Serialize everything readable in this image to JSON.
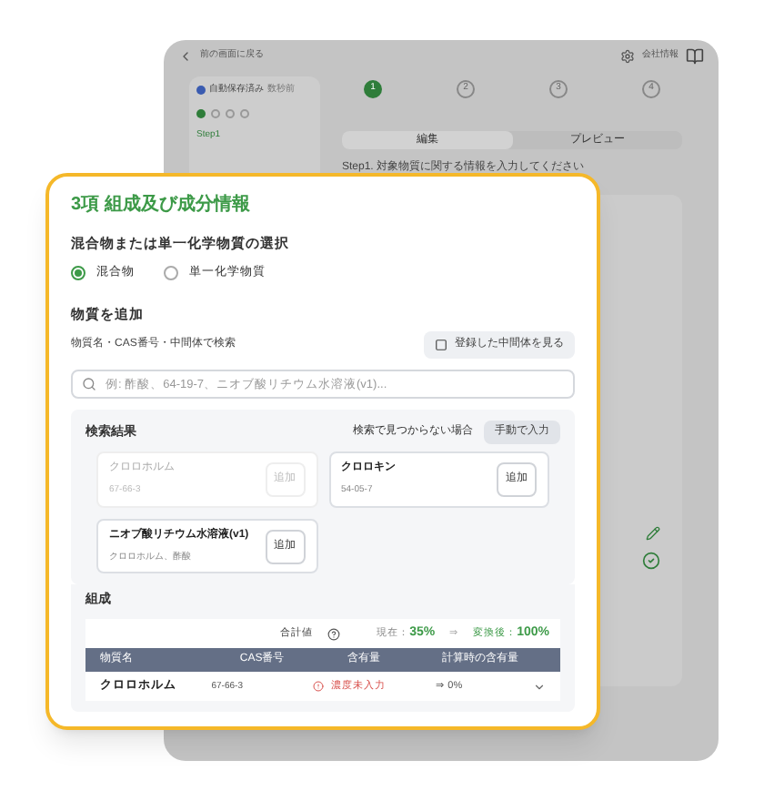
{
  "background_app": {
    "back_link": "前の画面に戻る",
    "company_info": "会社情報",
    "autosave": {
      "status": "自動保存済み",
      "time": "数秒前",
      "saved": true
    },
    "sidebar_step": "Step1",
    "steps": [
      {
        "number": "1",
        "current": true
      },
      {
        "number": "2",
        "current": false
      },
      {
        "number": "3",
        "current": false
      },
      {
        "number": "4",
        "current": false
      }
    ],
    "tabs": [
      {
        "label": "編集",
        "selected": true
      },
      {
        "label": "プレビュー",
        "selected": false
      }
    ],
    "heading": "Step1. 対象物質に関する情報を入力してください"
  },
  "card": {
    "title": "3項 組成及び成分情報",
    "type_section": {
      "heading": "混合物または単一化学物質の選択",
      "options": [
        {
          "label": "混合物",
          "selected": true
        },
        {
          "label": "単一化学物質",
          "selected": false
        }
      ]
    },
    "add_section": {
      "heading": "物質を追加",
      "search_label": "物質名・CAS番号・中間体で検索",
      "view_button": "登録した中間体を見る",
      "search_placeholder": "例: 酢酸、64-19-7、ニオブ酸リチウム水溶液(v1)..."
    },
    "results": {
      "heading": "検索結果",
      "not_found_text": "検索で見つからない場合",
      "manual_button": "手動で入力",
      "items": [
        {
          "name": "クロロホルム",
          "sub": "67-66-3",
          "disabled": true,
          "button": "追加"
        },
        {
          "name": "クロロキン",
          "sub": "54-05-7",
          "disabled": false,
          "button": "追加"
        },
        {
          "name": "ニオブ酸リチウム水溶液(v1)",
          "sub": "クロロホルム、酢酸",
          "disabled": false,
          "button": "追加"
        }
      ]
    },
    "composition": {
      "heading": "組成",
      "total_label": "合計値",
      "current_label": "現在：",
      "current_value": "35%",
      "arrow": "⇒",
      "target_label": "変換後：",
      "target_value": "100%",
      "columns": [
        "物質名",
        "CAS番号",
        "含有量",
        "計算時の含有量"
      ],
      "rows": [
        {
          "name": "クロロホルム",
          "cas": "67-66-3",
          "content": "濃度未入力",
          "calc": "⇒ 0%"
        }
      ]
    }
  }
}
